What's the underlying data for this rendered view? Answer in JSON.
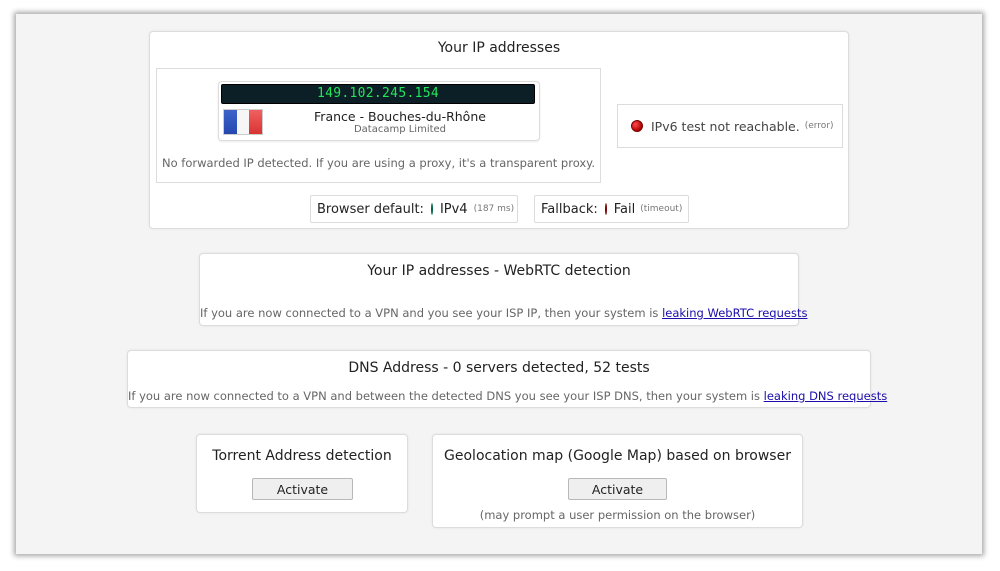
{
  "ip_card": {
    "title": "Your IP addresses",
    "ipv4": {
      "address": "149.102.245.154",
      "location": "France - Bouches-du-Rhône",
      "isp": "Datacamp Limited",
      "proxy_note": "No forwarded IP detected. If you are using a proxy, it's a transparent proxy."
    },
    "ipv6": {
      "status": "IPv6 test not reachable.",
      "detail": "(error)"
    },
    "browser_default": {
      "label": "Browser default:",
      "value": "IPv4",
      "detail": "(187 ms)"
    },
    "fallback": {
      "label": "Fallback:",
      "value": "Fail",
      "detail": "(timeout)"
    }
  },
  "webrtc": {
    "title": "Your IP addresses - WebRTC detection",
    "note": "If you are now connected to a VPN and you see your ISP IP, then your system is",
    "link": "leaking WebRTC requests"
  },
  "dns": {
    "title": "DNS Address - 0 servers detected, 52 tests",
    "note": "If you are now connected to a VPN and between the detected DNS you see your ISP DNS, then your system is",
    "link": "leaking DNS requests"
  },
  "torrent": {
    "title": "Torrent Address detection",
    "button": "Activate"
  },
  "geo": {
    "title": "Geolocation map (Google Map) based on browser",
    "button": "Activate",
    "note": "(may prompt a user permission on the browser)"
  },
  "colors": {
    "ip_display_bg": "#0c1e26",
    "ip_display_text": "#22e65a",
    "status_red": "#d00000",
    "status_green": "#12b812",
    "link": "#1a0dab"
  }
}
